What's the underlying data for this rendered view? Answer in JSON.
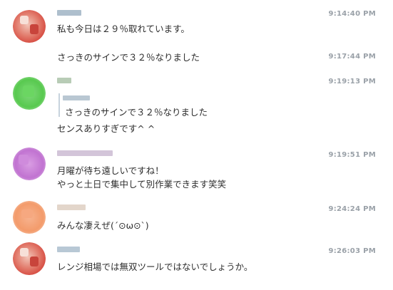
{
  "messages": [
    {
      "avatar_icon": "user-avatar-icon",
      "avatar_color": "#e2594f",
      "time": "9:14:40 PM",
      "lines": [
        "私も今日は２９％取れています。"
      ],
      "extra": [
        {
          "time": "9:17:44 PM",
          "text": "さっきのサインで３２％なりました"
        }
      ]
    },
    {
      "avatar_icon": "user-avatar-icon",
      "avatar_color": "#5fcf5a",
      "time": "9:19:13 PM",
      "quote_text": "さっきのサインで３２％なりました",
      "lines": [
        "センスありすぎです^ ^"
      ]
    },
    {
      "avatar_icon": "user-avatar-icon",
      "avatar_color": "#c97ad6",
      "time": "9:19:51 PM",
      "lines": [
        "月曜が待ち遠しいですね！",
        "やっと土日で集中して別作業できます笑笑"
      ]
    },
    {
      "avatar_icon": "user-avatar-icon",
      "avatar_color": "#f5a070",
      "time": "9:24:24 PM",
      "lines": [
        "みんな凄えぜ(´⊙ω⊙`)"
      ]
    },
    {
      "avatar_icon": "user-avatar-icon",
      "avatar_color": "#e2594f",
      "time": "9:26:03 PM",
      "lines": [
        "レンジ相場では無双ツールではないでしょうか。"
      ]
    }
  ]
}
